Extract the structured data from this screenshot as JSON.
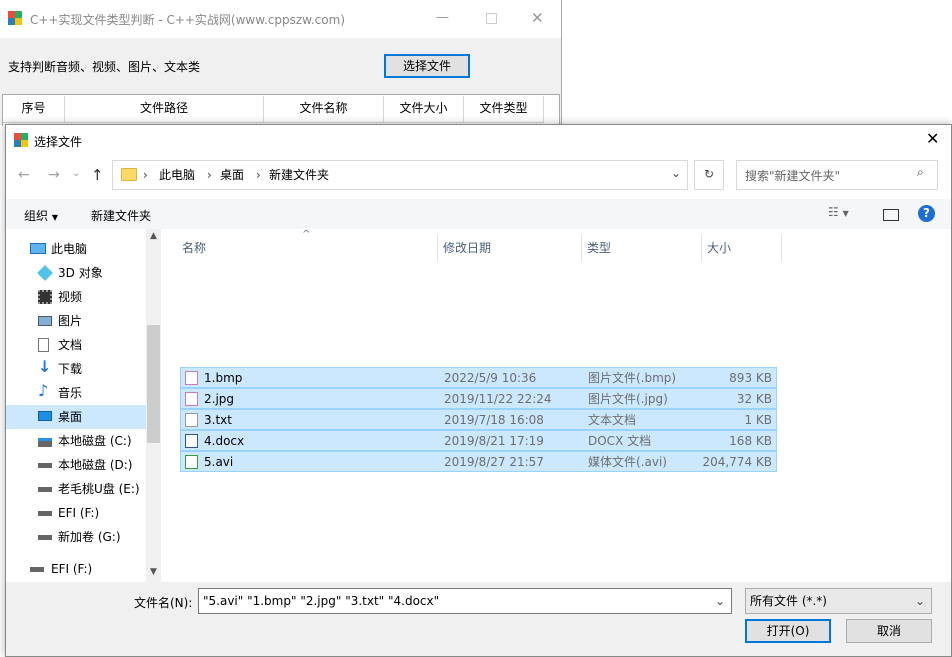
{
  "bg_window": {
    "title": "C++实现文件类型判断  - C++实战网(www.cppszw.com)",
    "label": "支持判断音频、视频、图片、文本类",
    "select_button": "选择文件",
    "columns": [
      "序号",
      "文件路径",
      "文件名称",
      "文件大小",
      "文件类型"
    ]
  },
  "dialog": {
    "title": "选择文件",
    "breadcrumb": [
      "此电脑",
      "桌面",
      "新建文件夹"
    ],
    "search_placeholder": "搜索\"新建文件夹\"",
    "toolbar": {
      "organize": "组织",
      "new_folder": "新建文件夹"
    },
    "sidebar": [
      {
        "label": "此电脑",
        "icon": "computer-icon",
        "level": 0
      },
      {
        "label": "3D 对象",
        "icon": "3d-objects-icon",
        "level": 1
      },
      {
        "label": "视频",
        "icon": "video-icon",
        "level": 1
      },
      {
        "label": "图片",
        "icon": "pictures-icon",
        "level": 1
      },
      {
        "label": "文档",
        "icon": "documents-icon",
        "level": 1
      },
      {
        "label": "下载",
        "icon": "download-icon",
        "level": 1
      },
      {
        "label": "音乐",
        "icon": "music-icon",
        "level": 1
      },
      {
        "label": "桌面",
        "icon": "desktop-icon",
        "level": 1,
        "selected": true
      },
      {
        "label": "本地磁盘 (C:)",
        "icon": "drive-c-icon",
        "level": 1
      },
      {
        "label": "本地磁盘 (D:)",
        "icon": "drive-icon",
        "level": 1
      },
      {
        "label": "老毛桃U盘 (E:)",
        "icon": "usb-drive-icon",
        "level": 1
      },
      {
        "label": "EFI (F:)",
        "icon": "drive-icon",
        "level": 1
      },
      {
        "label": "新加卷 (G:)",
        "icon": "drive-icon",
        "level": 1
      },
      {
        "label": "EFI (F:)",
        "icon": "drive-icon",
        "level": 0
      }
    ],
    "columns": {
      "name": "名称",
      "date": "修改日期",
      "type": "类型",
      "size": "大小"
    },
    "files": [
      {
        "name": "1.bmp",
        "date": "2022/5/9 10:36",
        "type": "图片文件(.bmp)",
        "size": "893 KB",
        "icon": "image-file-icon"
      },
      {
        "name": "2.jpg",
        "date": "2019/11/22 22:24",
        "type": "图片文件(.jpg)",
        "size": "32 KB",
        "icon": "image-file-icon"
      },
      {
        "name": "3.txt",
        "date": "2019/7/18 16:08",
        "type": "文本文档",
        "size": "1 KB",
        "icon": "text-file-icon"
      },
      {
        "name": "4.docx",
        "date": "2019/8/21 17:19",
        "type": "DOCX 文档",
        "size": "168 KB",
        "icon": "word-file-icon"
      },
      {
        "name": "5.avi",
        "date": "2019/8/27 21:57",
        "type": "媒体文件(.avi)",
        "size": "204,774 KB",
        "icon": "media-file-icon"
      }
    ],
    "filename_label": "文件名(N):",
    "filename_value": "\"5.avi\" \"1.bmp\" \"2.jpg\" \"3.txt\" \"4.docx\"",
    "filter_value": "所有文件 (*.*)",
    "open_button": "打开(O)",
    "cancel_button": "取消"
  }
}
